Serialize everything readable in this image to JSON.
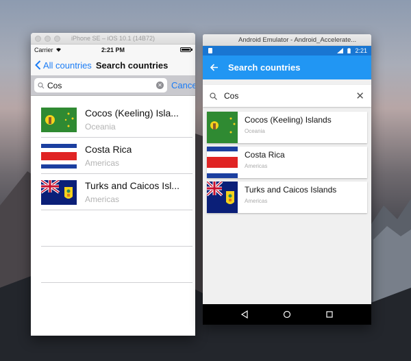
{
  "ios": {
    "window_title": "iPhone SE – iOS 10.1 (14B72)",
    "status": {
      "carrier": "Carrier",
      "time": "2:21 PM"
    },
    "nav": {
      "back_label": "All countries",
      "title": "Search countries"
    },
    "search": {
      "value": "Cos",
      "cancel_label": "Cancel"
    },
    "results": [
      {
        "name": "Cocos (Keeling) Isla...",
        "region": "Oceania",
        "flag": "cocos-keeling-flag"
      },
      {
        "name": "Costa Rica",
        "region": "Americas",
        "flag": "costa-rica-flag"
      },
      {
        "name": "Turks and Caicos Isl...",
        "region": "Americas",
        "flag": "turks-caicos-flag"
      }
    ]
  },
  "android": {
    "window_title": "Android Emulator - Android_Accelerate...",
    "status": {
      "time": "2:21"
    },
    "appbar": {
      "title": "Search countries"
    },
    "search": {
      "value": "Cos"
    },
    "results": [
      {
        "name": "Cocos (Keeling) Islands",
        "region": "Oceania",
        "flag": "cocos-keeling-flag"
      },
      {
        "name": "Costa Rica",
        "region": "Americas",
        "flag": "costa-rica-flag"
      },
      {
        "name": "Turks and Caicos Islands",
        "region": "Americas",
        "flag": "turks-caicos-flag"
      }
    ]
  },
  "colors": {
    "ios_accent": "#1b7cf5",
    "android_primary": "#2196f3",
    "android_primary_dark": "#1976d2"
  }
}
